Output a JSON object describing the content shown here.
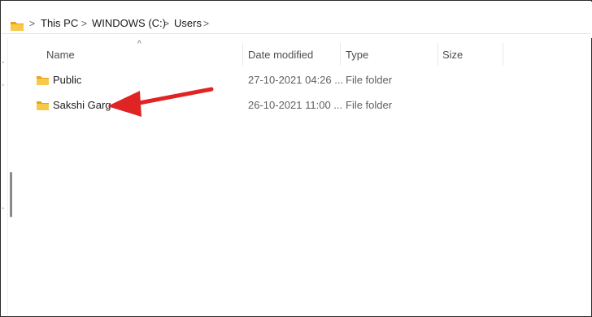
{
  "address_bar": {
    "breadcrumbs": [
      "This PC",
      "WINDOWS (C:)",
      "Users"
    ],
    "separator": ">"
  },
  "columns": {
    "name": "Name",
    "date_modified": "Date modified",
    "type": "Type",
    "size": "Size",
    "sort_indicator": "^"
  },
  "files": [
    {
      "name": "Public",
      "date_modified": "27-10-2021 04:26 ...",
      "type": "File folder",
      "icon": "folder-icon"
    },
    {
      "name": "Sakshi Garg",
      "date_modified": "26-10-2021 11:00 ...",
      "type": "File folder",
      "icon": "folder-icon"
    }
  ],
  "colors": {
    "folder_fill": "#f7c948",
    "folder_back": "#e8a317",
    "annotation_arrow": "#e02424"
  }
}
